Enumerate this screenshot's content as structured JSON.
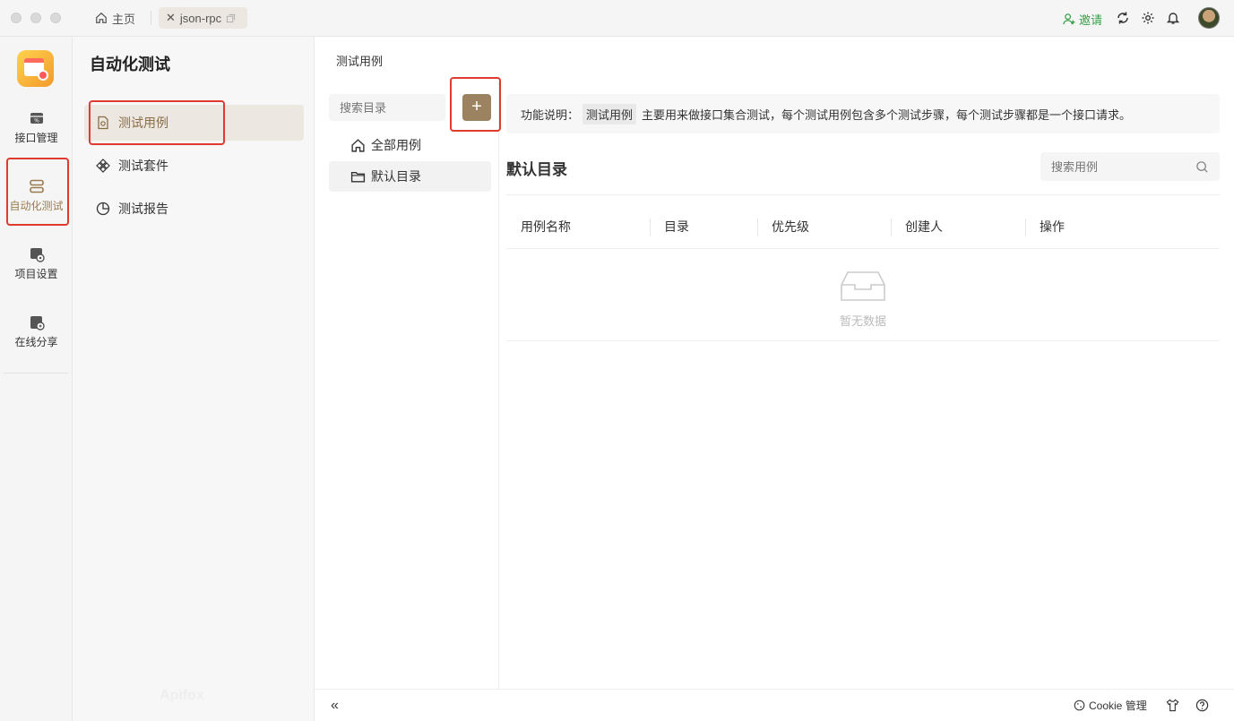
{
  "titlebar": {
    "home_tab": "主页",
    "active_tab": "json-rpc",
    "invite": "邀请"
  },
  "rail": {
    "items": [
      {
        "label": "接口管理",
        "icon": "api-icon"
      },
      {
        "label": "自动化测试",
        "icon": "automation-icon"
      },
      {
        "label": "项目设置",
        "icon": "settings-icon"
      },
      {
        "label": "在线分享",
        "icon": "share-icon"
      }
    ],
    "active_color": "#9a7b4f",
    "watermark": "Apifox"
  },
  "panel2": {
    "title": "自动化测试",
    "items": [
      {
        "label": "测试用例",
        "icon": "test-case-icon"
      },
      {
        "label": "测试套件",
        "icon": "test-suite-icon"
      },
      {
        "label": "测试报告",
        "icon": "report-icon"
      }
    ]
  },
  "main": {
    "breadcrumb": "测试用例",
    "dir_search_placeholder": "搜索目录",
    "add_label": "+",
    "dirs": [
      {
        "label": "全部用例",
        "icon": "home-icon"
      },
      {
        "label": "默认目录",
        "icon": "folder-icon"
      }
    ],
    "info": {
      "prefix": "功能说明：",
      "chip": "测试用例",
      "text": "主要用来做接口集合测试，每个测试用例包含多个测试步骤，每个测试步骤都是一个接口请求。"
    },
    "section_title": "默认目录",
    "case_search_placeholder": "搜索用例",
    "columns": [
      "用例名称",
      "目录",
      "优先级",
      "创建人",
      "操作"
    ],
    "empty_text": "暂无数据"
  },
  "bottombar": {
    "collapse": "«",
    "cookie": "Cookie 管理"
  },
  "colors": {
    "accent": "#9b8361",
    "highlight": "#e03a2f",
    "invite": "#3aa04a"
  }
}
